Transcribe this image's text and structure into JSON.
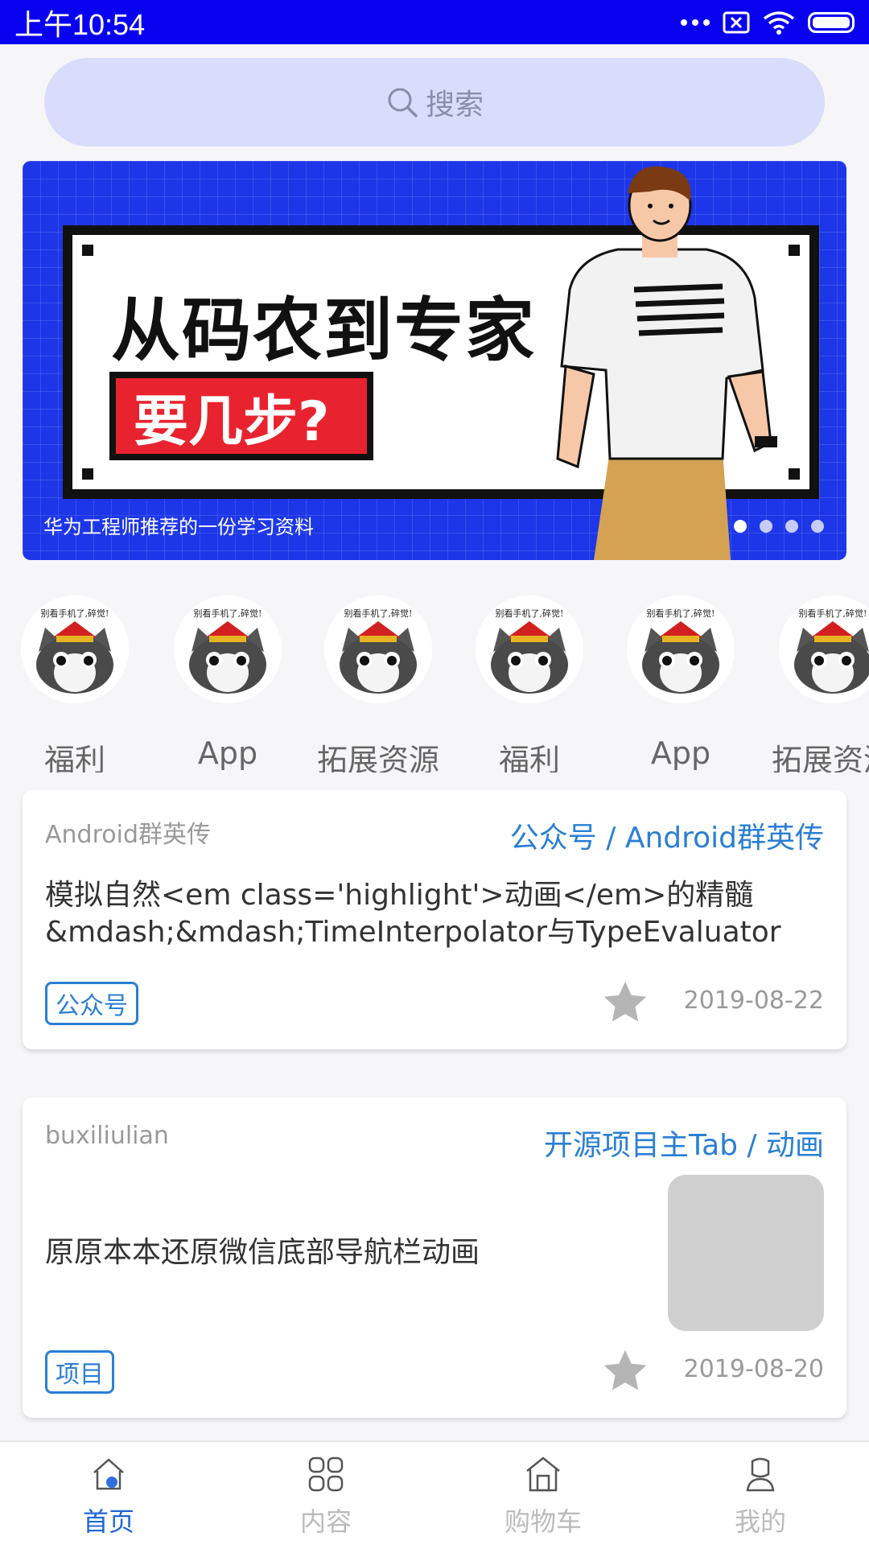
{
  "status_bar": {
    "time": "上午10:54"
  },
  "search": {
    "placeholder": "搜索"
  },
  "banner": {
    "title": "从码农到专家",
    "subtitle": "要几步?",
    "caption": "华为工程师推荐的一份学习资料",
    "page_count": 4,
    "active_page": 1
  },
  "categories": [
    {
      "label": "福利"
    },
    {
      "label": "App"
    },
    {
      "label": "拓展资源"
    },
    {
      "label": "福利"
    },
    {
      "label": "App"
    },
    {
      "label": "拓展资源"
    }
  ],
  "category_avatar_text": "别看手机了,碎觉!",
  "articles": [
    {
      "author": "Android群英传",
      "source": "公众号 / Android群英传",
      "title_line1": "模拟自然<em class='highlight'>动画</em>的精髓",
      "title_line2": "&mdash;&mdash;TimeInterpolator与TypeEvaluator",
      "tag": "公众号",
      "date": "2019-08-22"
    },
    {
      "author": "buxiliulian",
      "source": "开源项目主Tab / 动画",
      "title_line1": "原原本本还原微信底部导航栏动画",
      "tag": "项目",
      "date": "2019-08-20"
    }
  ],
  "bottom_nav": [
    {
      "label": "首页",
      "icon": "home-icon",
      "active": true
    },
    {
      "label": "内容",
      "icon": "grid-icon",
      "active": false
    },
    {
      "label": "购物车",
      "icon": "store-icon",
      "active": false
    },
    {
      "label": "我的",
      "icon": "user-icon",
      "active": false
    }
  ],
  "colors": {
    "status_bar": "#0a00f0",
    "accent": "#2a7fd4",
    "nav_active": "#1f66d6",
    "banner_bg": "#1d36e8",
    "banner_red": "#e8232f"
  }
}
